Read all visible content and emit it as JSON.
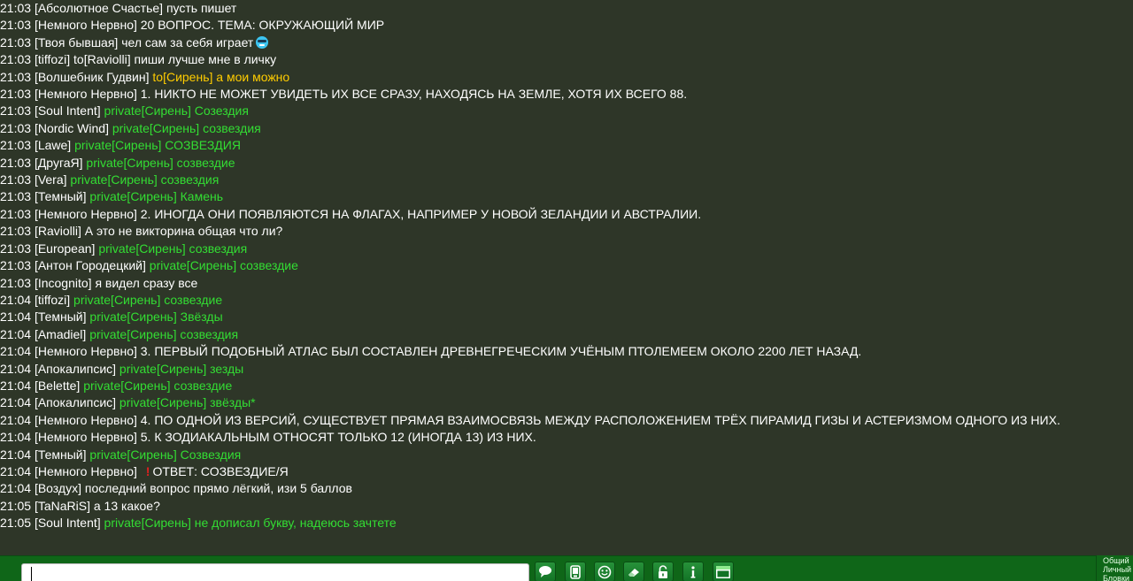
{
  "messages": [
    {
      "time": "21:03",
      "nick": "[Абсолютное Счастье]",
      "kind": "public",
      "text": "пусть пишет"
    },
    {
      "time": "21:03",
      "nick": "[Немного Нервно]",
      "kind": "public",
      "text": "20 ВОПРОС. ТЕМА: ОКРУЖАЮЩИЙ МИР"
    },
    {
      "time": "21:03",
      "nick": "[Твоя бывшая]",
      "kind": "public",
      "text": "чел сам за себя играет",
      "emoji": "cool-smiley-icon"
    },
    {
      "time": "21:03",
      "nick": "[tiffozi]",
      "kind": "public",
      "text": "to[Raviolli] пиши лучше мне в личку"
    },
    {
      "time": "21:03",
      "nick": "[Волшебник Гудвин]",
      "kind": "to",
      "tag": "to[Сирень]",
      "text": "а мои можно"
    },
    {
      "time": "21:03",
      "nick": "[Немного Нервно]",
      "kind": "public",
      "text": "1. НИКТО НЕ МОЖЕТ УВИДЕТЬ ИХ ВСЕ СРАЗУ, НАХОДЯСЬ НА ЗЕМЛЕ, ХОТЯ ИХ ВСЕГО 88."
    },
    {
      "time": "21:03",
      "nick": "[Soul Intent]",
      "kind": "private",
      "tag": "private[Сирень]",
      "text": "Созездия"
    },
    {
      "time": "21:03",
      "nick": "[Nordic Wind]",
      "kind": "private",
      "tag": "private[Сирень]",
      "text": "созвездия"
    },
    {
      "time": "21:03",
      "nick": "[Lawe]",
      "kind": "private",
      "tag": "private[Сирень]",
      "text": "СОЗВЕЗДИЯ"
    },
    {
      "time": "21:03",
      "nick": "[ДругаЯ]",
      "kind": "private",
      "tag": "private[Сирень]",
      "text": "созвездие"
    },
    {
      "time": "21:03",
      "nick": "[Vera]",
      "kind": "private",
      "tag": "private[Сирень]",
      "text": "созвездия"
    },
    {
      "time": "21:03",
      "nick": "[Темный]",
      "kind": "private",
      "tag": "private[Сирень]",
      "text": "Камень"
    },
    {
      "time": "21:03",
      "nick": "[Немного Нервно]",
      "kind": "public",
      "text": "2. ИНОГДА ОНИ ПОЯВЛЯЮТСЯ НА ФЛАГАХ, НАПРИМЕР У НОВОЙ ЗЕЛАНДИИ И АВСТРАЛИИ."
    },
    {
      "time": "21:03",
      "nick": "[Raviolli]",
      "kind": "public",
      "text": "А это не викторина общая что ли?"
    },
    {
      "time": "21:03",
      "nick": "[European]",
      "kind": "private",
      "tag": "private[Сирень]",
      "text": "созвездия"
    },
    {
      "time": "21:03",
      "nick": "[Антон Городецкий]",
      "kind": "private",
      "tag": "private[Сирень]",
      "text": "созвездие"
    },
    {
      "time": "21:03",
      "nick": "[Incognito]",
      "kind": "public",
      "text": "я видел сразу все"
    },
    {
      "time": "21:04",
      "nick": "[tiffozi]",
      "kind": "private",
      "tag": "private[Сирень]",
      "text": "созвездие"
    },
    {
      "time": "21:04",
      "nick": "[Темный]",
      "kind": "private",
      "tag": "private[Сирень]",
      "text": "Звёзды"
    },
    {
      "time": "21:04",
      "nick": "[Amadiel]",
      "kind": "private",
      "tag": "private[Сирень]",
      "text": "созвездия"
    },
    {
      "time": "21:04",
      "nick": "[Немного Нервно]",
      "kind": "public",
      "text": "3. ПЕРВЫЙ ПОДОБНЫЙ АТЛАС БЫЛ СОСТАВЛЕН ДРЕВНЕГРЕЧЕСКИМ УЧЁНЫМ ПТОЛЕМЕЕМ ОКОЛО 2200 ЛЕТ НАЗАД."
    },
    {
      "time": "21:04",
      "nick": "[Апокалипсис]",
      "kind": "private",
      "tag": "private[Сирень]",
      "text": "зезды"
    },
    {
      "time": "21:04",
      "nick": "[Belette]",
      "kind": "private",
      "tag": "private[Сирень]",
      "text": "созвездие"
    },
    {
      "time": "21:04",
      "nick": "[Апокалипсис]",
      "kind": "private",
      "tag": "private[Сирень]",
      "text": "звёзды*"
    },
    {
      "time": "21:04",
      "nick": "[Немного Нервно]",
      "kind": "public",
      "text": "4. ПО ОДНОЙ ИЗ ВЕРСИЙ, СУЩЕСТВУЕТ ПРЯМАЯ ВЗАИМОСВЯЗЬ МЕЖДУ РАСПОЛОЖЕНИЕМ ТРЁХ ПИРАМИД ГИЗЫ И АСТЕРИЗМОМ ОДНОГО ИЗ НИХ."
    },
    {
      "time": "21:04",
      "nick": "[Немного Нервно]",
      "kind": "public",
      "text": "5. К ЗОДИАКАЛЬНЫМ ОТНОСЯТ ТОЛЬКО 12 (ИНОГДА 13) ИЗ НИХ."
    },
    {
      "time": "21:04",
      "nick": "[Темный]",
      "kind": "private",
      "tag": "private[Сирень]",
      "text": "Созвездия"
    },
    {
      "time": "21:04",
      "nick": "[Немного Нервно]",
      "kind": "public",
      "alert": "!",
      "text": "ОТВЕТ: СОЗВЕЗДИЕ/Я"
    },
    {
      "time": "21:04",
      "nick": "[Воздух]",
      "kind": "public",
      "text": "последний вопрос прямо лёгкий, изи 5 баллов"
    },
    {
      "time": "21:05",
      "nick": "[TaNaRiS]",
      "kind": "public",
      "text": "а 13 какое?"
    },
    {
      "time": "21:05",
      "nick": "[Soul Intent]",
      "kind": "private",
      "tag": "private[Сирень]",
      "text": "не дописал букву, надеюсь зачтете"
    }
  ],
  "input": {
    "value": "",
    "placeholder": ""
  },
  "toolbar": [
    {
      "name": "chat-bubble-icon",
      "title": "chat"
    },
    {
      "name": "phone-icon",
      "title": "phone"
    },
    {
      "name": "smiley-icon",
      "title": "smiley"
    },
    {
      "name": "eraser-icon",
      "title": "eraser"
    },
    {
      "name": "lock-icon",
      "title": "lock"
    },
    {
      "name": "info-icon",
      "title": "i"
    },
    {
      "name": "window-icon",
      "title": "window"
    }
  ],
  "channels": [
    "Общий",
    "Личный",
    "Бловки"
  ],
  "colors": {
    "background": "#2e3628",
    "text": "#ffffff",
    "private": "#33dd33",
    "to": "#ffcc00",
    "bar": "#0f6618",
    "alert": "#e02020"
  }
}
